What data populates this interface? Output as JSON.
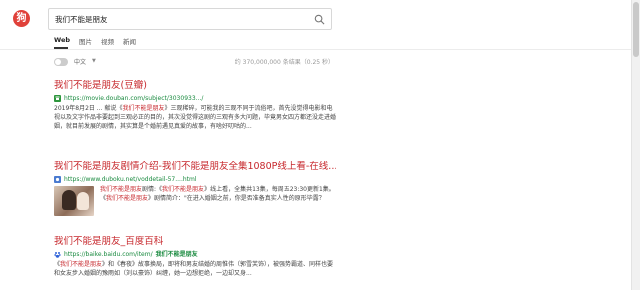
{
  "header": {
    "logo_char": "狗",
    "search_value": "我们不能是朋友"
  },
  "tabs": [
    {
      "label": "Web",
      "active": true
    },
    {
      "label": "图片",
      "active": false
    },
    {
      "label": "视频",
      "active": false
    },
    {
      "label": "新闻",
      "active": false
    }
  ],
  "filter": {
    "language": "中文",
    "result_count": "约 370,000,000 条结果（0.25 秒）"
  },
  "results": [
    {
      "title_main": "我们不能是朋友",
      "title_rest": "(豆瓣)",
      "url": "https://movie.douban.com/subject/3030933.../",
      "snippet": [
        {
          "t": "2019年8月2日 ... 献说《",
          "hl": false
        },
        {
          "t": "我们不能是朋友",
          "hl": true
        },
        {
          "t": "》三观稀碎，可能我的三观不同于流俗吧，首先没觉得电影和电视以及文字作品非要起到三观必正的目的，其次没觉得这剧的三观有多大问题，毕竟男女四方都还没走进婚姻，就目前发展的剧情，其实算是个婚前遇见真爱的故事，有啥好叨咕的...",
          "hl": false
        }
      ]
    },
    {
      "title_a": "我们不能是朋友",
      "title_b": "剧情介绍-",
      "title_c": "我们不能是朋友",
      "title_d": "全集1080P线上看-在线...",
      "url": "https://www.duboku.net/voddetail-57....html",
      "snippet": [
        {
          "t": "我们不能是朋友",
          "hl": true
        },
        {
          "t": "剧情:《",
          "hl": false
        },
        {
          "t": "我们不能是朋友",
          "hl": true
        },
        {
          "t": "》线上看，全集共13集，每周五23:30更新1集。《",
          "hl": false
        },
        {
          "t": "我们不能是朋友",
          "hl": true
        },
        {
          "t": "》剧情简介：\"在进入婚姻之前，你是否准备真实人性的原形毕露？",
          "hl": false
        }
      ]
    },
    {
      "title_a": "我们不能是朋友",
      "title_b": "_百度百科",
      "url_prefix": "https://baike.baidu.com/item/",
      "url_bold": "我们不能是朋友",
      "snippet": [
        {
          "t": "《",
          "hl": false
        },
        {
          "t": "我们不能是朋友",
          "hl": true
        },
        {
          "t": "》和《春夜》故事换局，即将和男友结婚的周惟伟（郭雪芙饰），被强势霸道、同样也要和女友步入婚姻的豫雨如（刘以豪饰）纠缠，她一边想拒绝，一边却又身...",
          "hl": false
        }
      ]
    }
  ]
}
